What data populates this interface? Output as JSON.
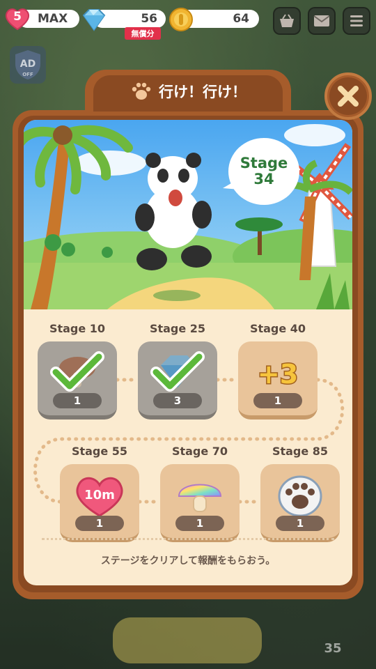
{
  "hud": {
    "lives_count": "5",
    "lives_label": "MAX",
    "gems_value": "56",
    "free_badge": "無償分",
    "coins_value": "64"
  },
  "side": {
    "ad_label": "AD",
    "ad_sub": "OFF"
  },
  "modal": {
    "title": "行け！行け！",
    "banner_stage_label": "Stage",
    "banner_stage_number": "34",
    "hint": "ステージをクリアして報酬をもらおう。"
  },
  "rewards": [
    {
      "label": "Stage 10",
      "count": "1",
      "item": "mushroom-icon",
      "completed": true
    },
    {
      "label": "Stage 25",
      "count": "3",
      "item": "gem-icon",
      "completed": true
    },
    {
      "label": "Stage 40",
      "count": "1",
      "item": "plus-three-icon",
      "completed": false,
      "art_text": "+3"
    },
    {
      "label": "Stage 55",
      "count": "1",
      "item": "heart-10m-icon",
      "completed": false,
      "art_text": "10m"
    },
    {
      "label": "Stage 70",
      "count": "1",
      "item": "rainbow-mushroom-icon",
      "completed": false
    },
    {
      "label": "Stage 85",
      "count": "1",
      "item": "paw-icon",
      "completed": false
    }
  ],
  "footer": {
    "counter": "35"
  },
  "colors": {
    "frame": "#a65c2b",
    "frame_dark": "#8a4a22",
    "body": "#fbebd0",
    "card": "#e9c49a",
    "card_done": "#a6a19a",
    "check": "#5cb83a",
    "stage_text": "#2f7a3a",
    "free_badge": "#e2304a"
  }
}
